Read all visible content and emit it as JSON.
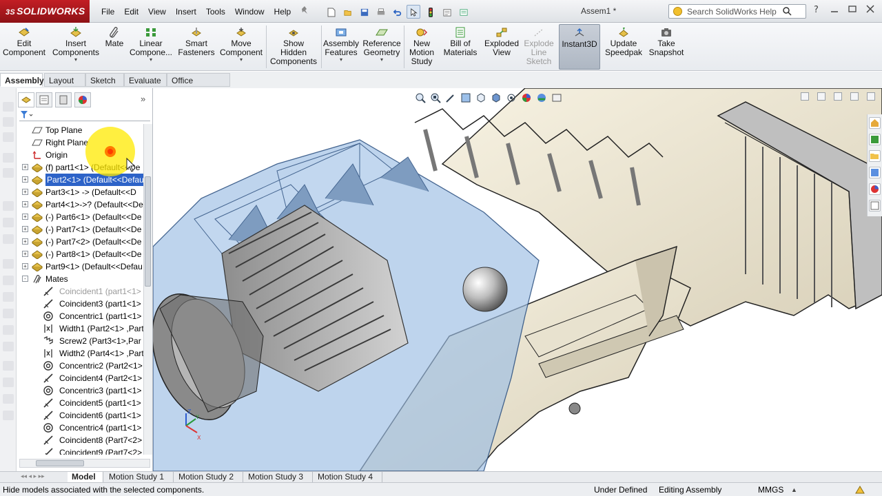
{
  "app": {
    "brand_prefix": "3S",
    "brand": "SOLIDWORKS",
    "doc_title": "Assem1 *"
  },
  "menu": [
    "File",
    "Edit",
    "View",
    "Insert",
    "Tools",
    "Window",
    "Help"
  ],
  "search": {
    "placeholder": "Search SolidWorks Help"
  },
  "toolbar": {
    "buttons": [
      {
        "label": "Edit\nComponent",
        "icon": "edit-component-icon"
      },
      {
        "label": "Insert\nComponents",
        "icon": "insert-components-icon"
      },
      {
        "label": "Mate",
        "icon": "mate-icon"
      },
      {
        "label": "Linear\nCompone...",
        "icon": "linear-pattern-icon"
      },
      {
        "label": "Smart\nFasteners",
        "icon": "smart-fasteners-icon"
      },
      {
        "label": "Move\nComponent",
        "icon": "move-component-icon"
      },
      {
        "label": "Show\nHidden\nComponents",
        "icon": "show-hidden-icon"
      },
      {
        "label": "Assembly\nFeatures",
        "icon": "assembly-features-icon"
      },
      {
        "label": "Reference\nGeometry",
        "icon": "reference-geometry-icon"
      },
      {
        "label": "New\nMotion\nStudy",
        "icon": "motion-study-icon"
      },
      {
        "label": "Bill of\nMaterials",
        "icon": "bom-icon"
      },
      {
        "label": "Exploded\nView",
        "icon": "exploded-view-icon"
      },
      {
        "label": "Explode\nLine\nSketch",
        "icon": "explode-line-icon"
      },
      {
        "label": "Instant3D",
        "icon": "instant3d-icon"
      },
      {
        "label": "Update\nSpeedpak",
        "icon": "speedpak-icon"
      },
      {
        "label": "Take\nSnapshot",
        "icon": "snapshot-icon"
      }
    ]
  },
  "cmd_tabs": [
    "Assembly",
    "Layout",
    "Sketch",
    "Evaluate",
    "Office Products"
  ],
  "tree": [
    {
      "label": "Top Plane",
      "icon": "plane-icon",
      "expand": ""
    },
    {
      "label": "Right Plane",
      "icon": "plane-icon",
      "expand": ""
    },
    {
      "label": "Origin",
      "icon": "origin-icon",
      "expand": ""
    },
    {
      "label": "(f) part1<1> (Default<<De",
      "icon": "part-icon",
      "expand": "+"
    },
    {
      "label": "Part2<1> (Default<<Defau",
      "icon": "part-icon",
      "expand": "+"
    },
    {
      "label": "Part3<1> -> (Default<<D",
      "icon": "part-icon",
      "expand": "+"
    },
    {
      "label": "Part4<1>->? (Default<<De",
      "icon": "part-icon",
      "expand": "+"
    },
    {
      "label": "(-) Part6<1> (Default<<De",
      "icon": "part-icon",
      "expand": "+"
    },
    {
      "label": "(-) Part7<1> (Default<<De",
      "icon": "part-icon",
      "expand": "+"
    },
    {
      "label": "(-) Part7<2> (Default<<De",
      "icon": "part-icon",
      "expand": "+"
    },
    {
      "label": "(-) Part8<1> (Default<<De",
      "icon": "part-icon",
      "expand": "+"
    },
    {
      "label": "Part9<1> (Default<<Defau",
      "icon": "part-icon",
      "expand": "+"
    },
    {
      "label": "Mates",
      "icon": "mates-folder-icon",
      "expand": "-"
    },
    {
      "label": "Coincident1 (part1<1>",
      "icon": "coincident-icon",
      "expand": ""
    },
    {
      "label": "Coincident3 (part1<1>",
      "icon": "coincident-icon",
      "expand": ""
    },
    {
      "label": "Concentric1 (part1<1>",
      "icon": "concentric-icon",
      "expand": ""
    },
    {
      "label": "Width1 (Part2<1> ,Part",
      "icon": "width-mate-icon",
      "expand": ""
    },
    {
      "label": "Screw2 (Part3<1>,Par",
      "icon": "screw-mate-icon",
      "expand": ""
    },
    {
      "label": "Width2 (Part4<1> ,Part",
      "icon": "width-mate-icon",
      "expand": ""
    },
    {
      "label": "Concentric2 (Part2<1>",
      "icon": "concentric-icon",
      "expand": ""
    },
    {
      "label": "Coincident4 (Part2<1>",
      "icon": "coincident-icon",
      "expand": ""
    },
    {
      "label": "Concentric3 (part1<1>",
      "icon": "concentric-icon",
      "expand": ""
    },
    {
      "label": "Coincident5 (part1<1>",
      "icon": "coincident-icon",
      "expand": ""
    },
    {
      "label": "Coincident6 (part1<1>",
      "icon": "coincident-icon",
      "expand": ""
    },
    {
      "label": "Concentric4 (part1<1>",
      "icon": "concentric-icon",
      "expand": ""
    },
    {
      "label": "Coincident8 (Part7<2>",
      "icon": "coincident-icon",
      "expand": ""
    },
    {
      "label": "Coincident9 (Part7<2>",
      "icon": "coincident-icon",
      "expand": ""
    }
  ],
  "tree_selected_index": 4,
  "tree_dim_index": 13,
  "bottom_tabs": [
    "Model",
    "Motion Study 1",
    "Motion Study 2",
    "Motion Study 3",
    "Motion Study 4"
  ],
  "status": {
    "message": "Hide models associated with the selected components.",
    "state": "Under Defined",
    "mode": "Editing Assembly",
    "units": "MMGS"
  },
  "colors": {
    "brand": "#c21e24",
    "selection": "#2d63c8",
    "transparent_part": "#8fb1d9",
    "solid_part": "#f0ead8"
  }
}
